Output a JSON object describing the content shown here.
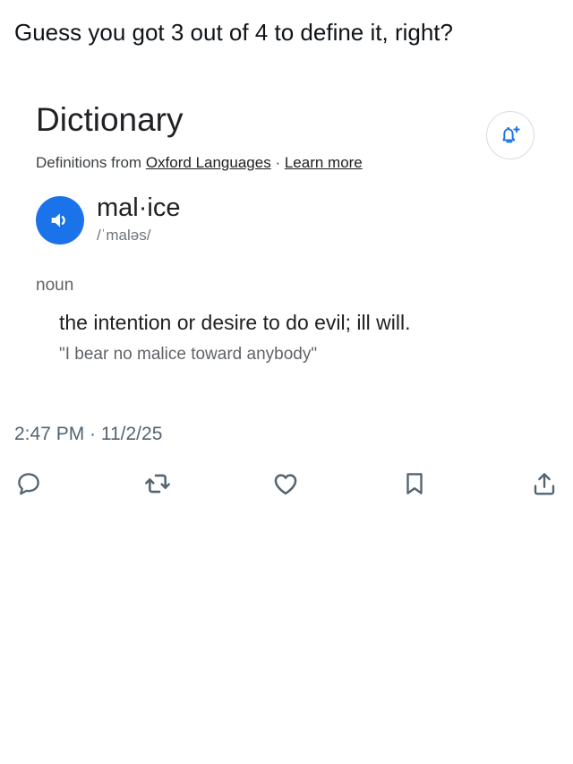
{
  "tweet": {
    "text": "Guess you got 3 out of 4 to define it, right?",
    "timestamp": "2:47 PM · 11/2/25"
  },
  "dictionary": {
    "title": "Dictionary",
    "source_prefix": "Definitions from ",
    "source_link": "Oxford Languages",
    "separator": " · ",
    "learn_more": "Learn more",
    "word": "mal·ice",
    "phonetic": "/ˈmaləs/",
    "part_of_speech": "noun",
    "definition": "the intention or desire to do evil; ill will.",
    "example": "\"I bear no malice toward anybody\"",
    "audio_icon": "speaker-icon",
    "alert_icon": "bell-plus-icon",
    "accent_color": "#1a73e8"
  },
  "actions": [
    {
      "name": "reply",
      "icon": "reply-icon"
    },
    {
      "name": "retweet",
      "icon": "retweet-icon"
    },
    {
      "name": "like",
      "icon": "heart-icon"
    },
    {
      "name": "bookmark",
      "icon": "bookmark-icon"
    },
    {
      "name": "share",
      "icon": "share-icon"
    }
  ]
}
